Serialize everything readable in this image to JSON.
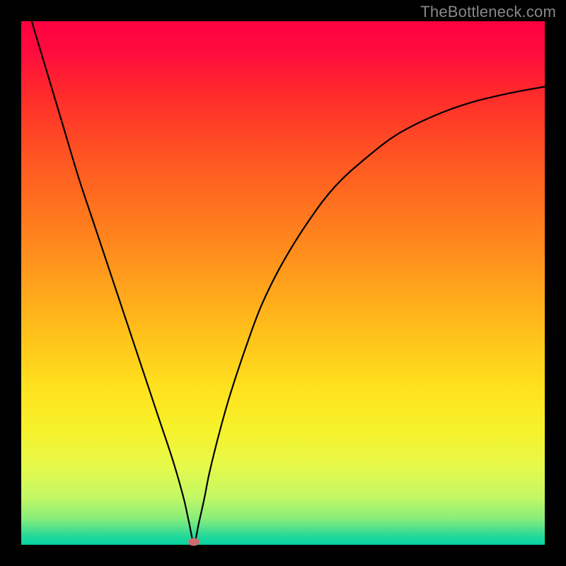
{
  "watermark": "TheBottleneck.com",
  "colors": {
    "frame": "#000000",
    "curve": "#000000",
    "marker": "#cf6b6b",
    "watermark": "#888888"
  },
  "chart_data": {
    "type": "line",
    "title": "",
    "xlabel": "",
    "ylabel": "",
    "xlim": [
      0,
      100
    ],
    "ylim": [
      0,
      100
    ],
    "grid": false,
    "legend": false,
    "marker": {
      "x": 33,
      "y": 0.5
    },
    "series": [
      {
        "name": "bottleneck-curve",
        "x": [
          2,
          5,
          8,
          11,
          14,
          17,
          20,
          23,
          26,
          29,
          31,
          32,
          33,
          34,
          35,
          36,
          38,
          40,
          43,
          46,
          50,
          55,
          60,
          66,
          72,
          79,
          86,
          93,
          100
        ],
        "values": [
          100,
          90,
          80,
          70,
          61,
          52,
          43,
          34,
          25,
          16,
          9,
          4.5,
          0.5,
          4.5,
          9,
          14,
          22,
          29,
          38,
          46,
          54,
          62,
          68.5,
          74,
          78.5,
          82,
          84.5,
          86.2,
          87.5
        ]
      }
    ],
    "gradient_stops": [
      {
        "pos": 0,
        "color": "#ff0040"
      },
      {
        "pos": 0.14,
        "color": "#ff2b2b"
      },
      {
        "pos": 0.38,
        "color": "#ff7a1e"
      },
      {
        "pos": 0.6,
        "color": "#ffc21a"
      },
      {
        "pos": 0.78,
        "color": "#f6f22a"
      },
      {
        "pos": 0.95,
        "color": "#88ed7a"
      },
      {
        "pos": 1.0,
        "color": "#08d3a2"
      }
    ]
  }
}
